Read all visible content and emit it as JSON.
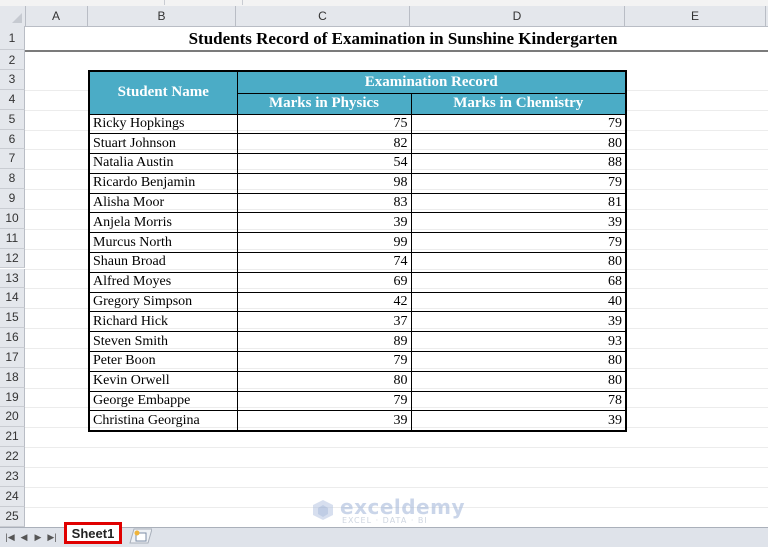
{
  "app": {
    "sheet_tabs": [
      {
        "label": "Sheet1",
        "active": true
      }
    ],
    "new_sheet_icon": "insert-worksheet-icon",
    "tab_nav_icons": [
      "first-sheet-icon",
      "prev-sheet-icon",
      "next-sheet-icon",
      "last-sheet-icon"
    ]
  },
  "grid": {
    "columns": [
      "A",
      "B",
      "C",
      "D",
      "E"
    ],
    "rows": [
      "1",
      "2",
      "3",
      "4",
      "5",
      "6",
      "7",
      "8",
      "9",
      "10",
      "11",
      "12",
      "13",
      "14",
      "15",
      "16",
      "17",
      "18",
      "19",
      "20",
      "21",
      "22",
      "23",
      "24",
      "25"
    ]
  },
  "sheet": {
    "title": "Students Record of Examination in Sunshine Kindergarten",
    "table": {
      "header_name": "Student Name",
      "header_group": "Examination Record",
      "header_physics": "Marks in Physics",
      "header_chemistry": "Marks in Chemistry",
      "rows": [
        {
          "name": "Ricky Hopkings",
          "physics": "75",
          "chemistry": "79"
        },
        {
          "name": "Stuart Johnson",
          "physics": "82",
          "chemistry": "80"
        },
        {
          "name": "Natalia Austin",
          "physics": "54",
          "chemistry": "88"
        },
        {
          "name": "Ricardo Benjamin",
          "physics": "98",
          "chemistry": "79"
        },
        {
          "name": "Alisha Moor",
          "physics": "83",
          "chemistry": "81"
        },
        {
          "name": "Anjela Morris",
          "physics": "39",
          "chemistry": "39"
        },
        {
          "name": "Murcus North",
          "physics": "99",
          "chemistry": "79"
        },
        {
          "name": "Shaun Broad",
          "physics": "74",
          "chemistry": "80"
        },
        {
          "name": "Alfred Moyes",
          "physics": "69",
          "chemistry": "68"
        },
        {
          "name": "Gregory Simpson",
          "physics": "42",
          "chemistry": "40"
        },
        {
          "name": "Richard Hick",
          "physics": "37",
          "chemistry": "39"
        },
        {
          "name": "Steven Smith",
          "physics": "89",
          "chemistry": "93"
        },
        {
          "name": "Peter Boon",
          "physics": "79",
          "chemistry": "80"
        },
        {
          "name": "Kevin Orwell",
          "physics": "80",
          "chemistry": "80"
        },
        {
          "name": "George Embappe",
          "physics": "79",
          "chemistry": "78"
        },
        {
          "name": "Christina Georgina",
          "physics": "39",
          "chemistry": "39"
        }
      ]
    }
  },
  "watermark": {
    "brand": "exceldemy",
    "tagline": "EXCEL · DATA · BI"
  },
  "colors": {
    "header_fill": "#4bacc6",
    "header_text": "#ffffff",
    "active_tab_highlight": "#e00000"
  }
}
